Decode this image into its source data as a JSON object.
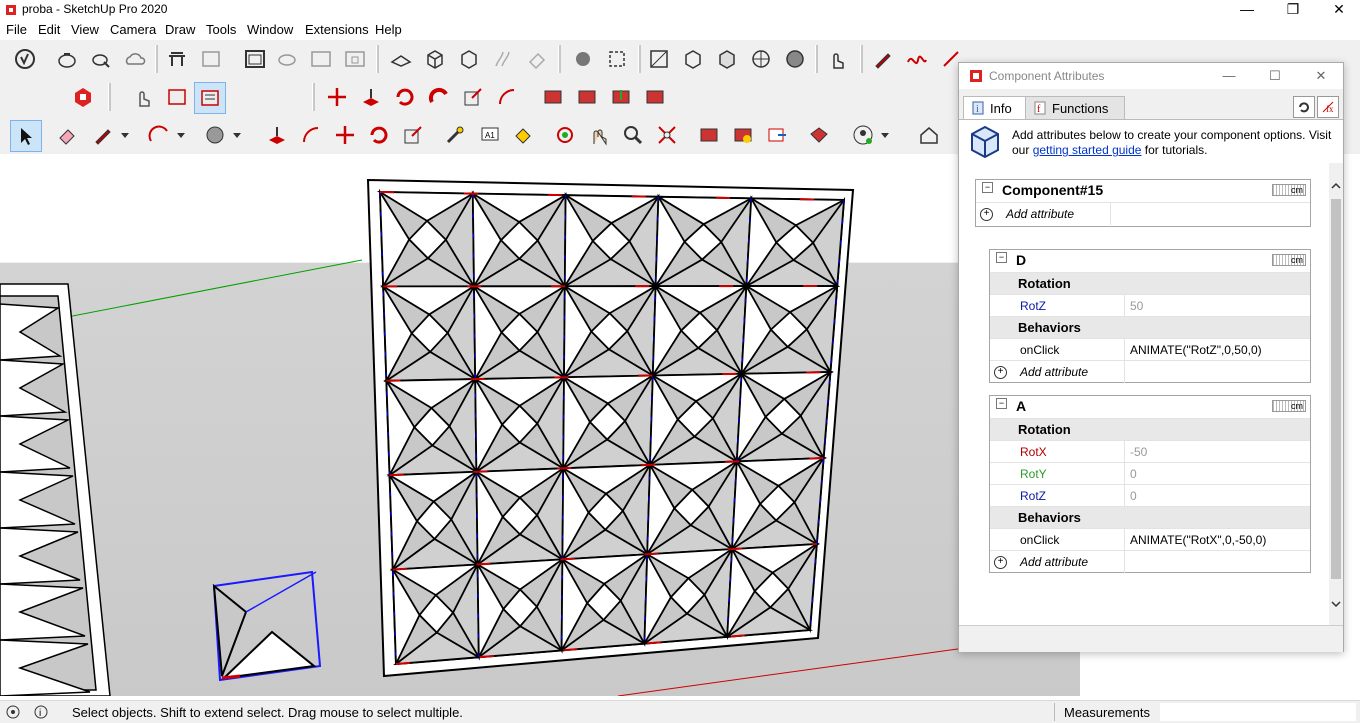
{
  "window": {
    "title": "proba - SketchUp Pro 2020",
    "min": "—",
    "max": "❐",
    "close": "✕"
  },
  "menu": [
    "File",
    "Edit",
    "View",
    "Camera",
    "Draw",
    "Tools",
    "Window",
    "Extensions",
    "Help"
  ],
  "dialog": {
    "title": "Component Attributes",
    "tabs": [
      {
        "label": "Info"
      },
      {
        "label": "Functions"
      }
    ],
    "banner": {
      "prefix": "Add attributes below to create your component options. Visit our ",
      "link": "getting started guide",
      "suffix": " for tutorials."
    },
    "unit_label": "cm",
    "component": {
      "name": "Component#15",
      "add": "Add attribute"
    },
    "subcomponents": [
      {
        "name": "D",
        "rows": [
          {
            "type": "group",
            "label": "Rotation"
          },
          {
            "type": "attr",
            "key": "RotZ",
            "value": "50",
            "key_color": "#0a1aa8",
            "value_color": "#999999"
          },
          {
            "type": "group",
            "label": "Behaviors"
          },
          {
            "type": "attr",
            "key": "onClick",
            "value": "ANIMATE(\"RotZ\",0,50,0)",
            "key_color": "#000000",
            "value_color": "#000000"
          },
          {
            "type": "add",
            "label": "Add attribute"
          }
        ]
      },
      {
        "name": "A",
        "rows": [
          {
            "type": "group",
            "label": "Rotation"
          },
          {
            "type": "attr",
            "key": "RotX",
            "value": "-50",
            "key_color": "#b00000",
            "value_color": "#999999"
          },
          {
            "type": "attr",
            "key": "RotY",
            "value": "0",
            "key_color": "#2a9a2a",
            "value_color": "#999999"
          },
          {
            "type": "attr",
            "key": "RotZ",
            "value": "0",
            "key_color": "#0a1aa8",
            "value_color": "#999999"
          },
          {
            "type": "group",
            "label": "Behaviors"
          },
          {
            "type": "attr",
            "key": "onClick",
            "value": "ANIMATE(\"RotX\",0,-50,0)",
            "key_color": "#000000",
            "value_color": "#000000"
          },
          {
            "type": "add",
            "label": "Add attribute"
          }
        ]
      }
    ]
  },
  "status": {
    "message": "Select objects. Shift to extend select. Drag mouse to select multiple.",
    "measurements": "Measurements"
  },
  "colors": {
    "axis_red": "#cc0000",
    "axis_green": "#00a000",
    "axis_blue": "#0000cc",
    "panel_face": "#c8c8c8",
    "selection": "#1a1aff"
  }
}
